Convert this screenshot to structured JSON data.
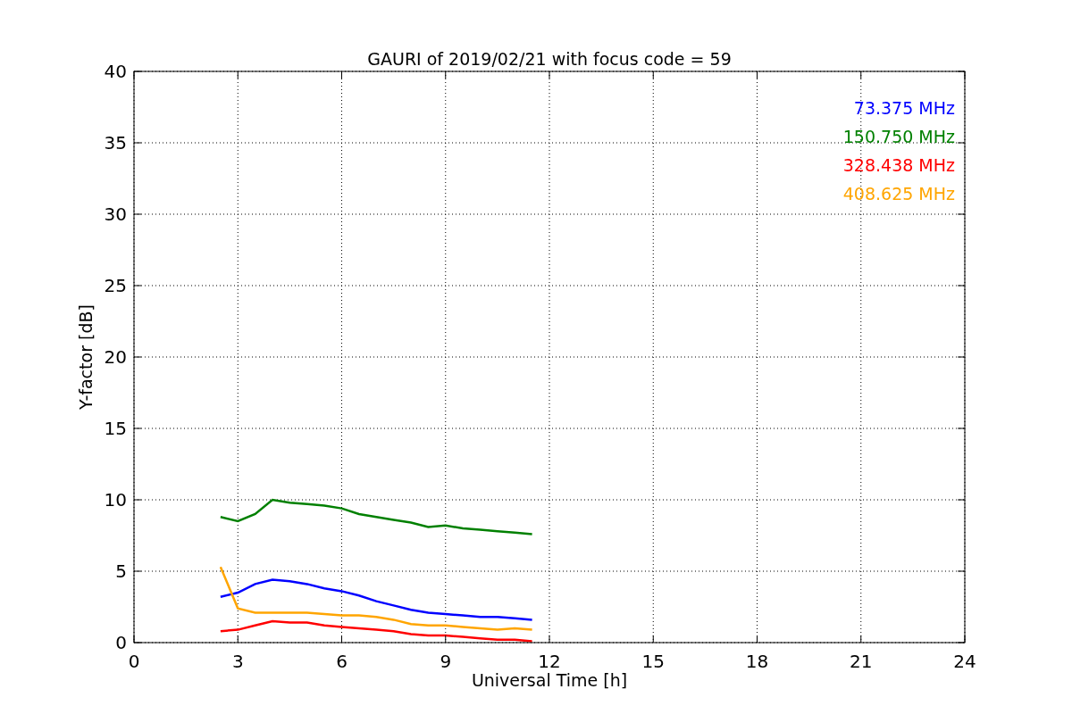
{
  "chart_data": {
    "type": "line",
    "title": "GAURI of 2019/02/21 with focus code = 59",
    "xlabel": "Universal Time [h]",
    "ylabel": "Y-factor [dB]",
    "x": [
      2.5,
      3,
      3.5,
      4,
      4.5,
      5,
      5.5,
      6,
      6.5,
      7,
      7.5,
      8,
      8.5,
      9,
      9.5,
      10,
      10.5,
      11,
      11.5
    ],
    "series": [
      {
        "name": "73.375 MHz",
        "color": "#0000ff",
        "values": [
          3.2,
          3.5,
          4.1,
          4.4,
          4.3,
          4.1,
          3.8,
          3.6,
          3.3,
          2.9,
          2.6,
          2.3,
          2.1,
          2.0,
          1.9,
          1.8,
          1.8,
          1.7,
          1.6
        ]
      },
      {
        "name": "150.750 MHz",
        "color": "#008000",
        "values": [
          8.8,
          8.5,
          9.0,
          10.0,
          9.8,
          9.7,
          9.6,
          9.4,
          9.0,
          8.8,
          8.6,
          8.4,
          8.1,
          8.2,
          8.0,
          7.9,
          7.8,
          7.7,
          7.6
        ]
      },
      {
        "name": "328.438 MHz",
        "color": "#ff0000",
        "values": [
          0.8,
          0.9,
          1.2,
          1.5,
          1.4,
          1.4,
          1.2,
          1.1,
          1.0,
          0.9,
          0.8,
          0.6,
          0.5,
          0.5,
          0.4,
          0.3,
          0.2,
          0.2,
          0.1
        ]
      },
      {
        "name": "408.625 MHz",
        "color": "#ffa500",
        "values": [
          5.3,
          2.4,
          2.1,
          2.1,
          2.1,
          2.1,
          2.0,
          1.9,
          1.9,
          1.8,
          1.6,
          1.3,
          1.2,
          1.2,
          1.1,
          1.0,
          0.9,
          1.0,
          0.9
        ]
      }
    ],
    "xlim": [
      0,
      24
    ],
    "ylim": [
      0,
      40
    ],
    "xticks": [
      0,
      3,
      6,
      9,
      12,
      15,
      18,
      21,
      24
    ],
    "yticks": [
      0,
      5,
      10,
      15,
      20,
      25,
      30,
      35,
      40
    ],
    "grid": true
  }
}
